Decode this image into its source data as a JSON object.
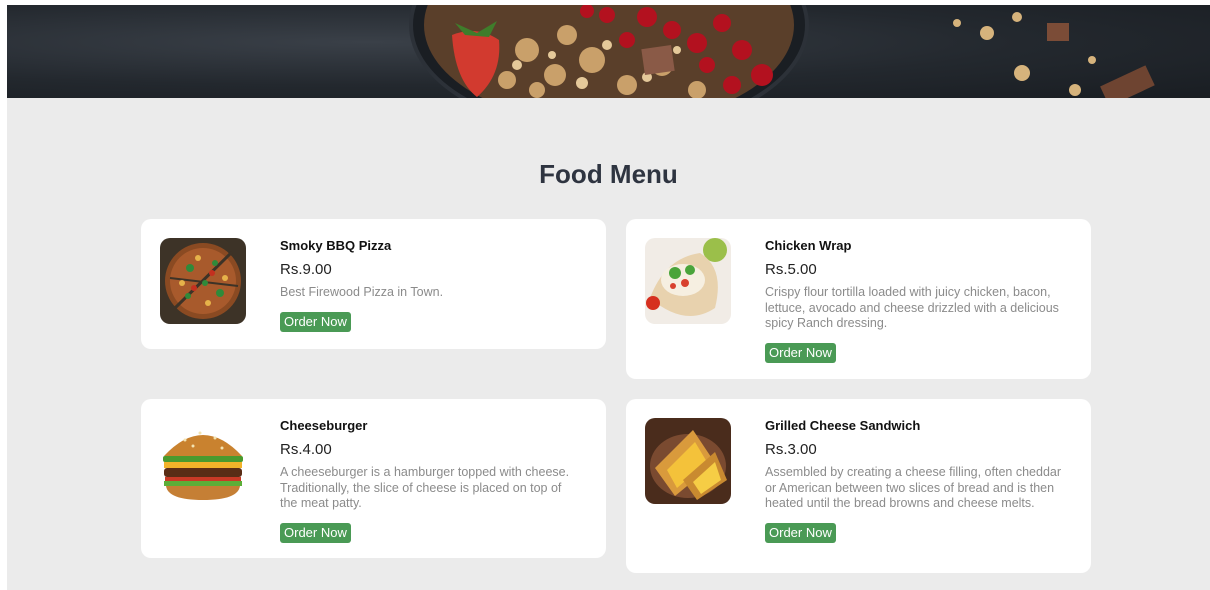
{
  "page": {
    "title": "Food Menu"
  },
  "hero": {
    "image": "granola-berries-chocolate-banner"
  },
  "menu": [
    {
      "name": "Smoky BBQ Pizza",
      "price": "Rs.9.00",
      "description": "Best Firewood Pizza in Town.",
      "button": "Order Now",
      "image": "pizza"
    },
    {
      "name": "Chicken Wrap",
      "price": "Rs.5.00",
      "description": "Crispy flour tortilla loaded with juicy chicken, bacon, lettuce, avocado and cheese drizzled with a delicious spicy Ranch dressing.",
      "button": "Order Now",
      "image": "chicken-wrap"
    },
    {
      "name": "Cheeseburger",
      "price": "Rs.4.00",
      "description": "A cheeseburger is a hamburger topped with cheese. Traditionally, the slice of cheese is placed on top of the meat patty.",
      "button": "Order Now",
      "image": "cheeseburger"
    },
    {
      "name": "Grilled Cheese Sandwich",
      "price": "Rs.3.00",
      "description": "Assembled by creating a cheese filling, often cheddar or American between two slices of bread and is then heated until the bread browns and cheese melts.",
      "button": "Order Now",
      "image": "grilled-cheese-sandwich"
    }
  ],
  "colors": {
    "background": "#ebebeb",
    "card": "#ffffff",
    "button": "#4a9a55",
    "title": "#2e3440",
    "description": "#8b8b8b"
  }
}
